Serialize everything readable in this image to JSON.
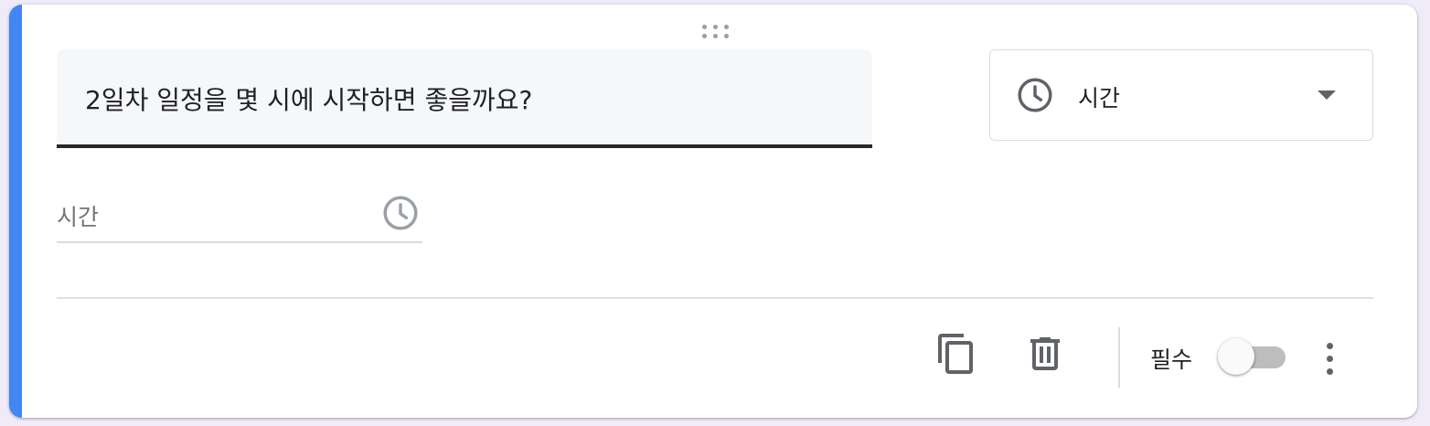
{
  "question": {
    "title": "2일차 일정을 몇 시에 시작하면 좋을까요?"
  },
  "type_selector": {
    "label": "시간",
    "icon": "clock-icon"
  },
  "answer_field": {
    "placeholder": "시간",
    "icon": "clock-icon"
  },
  "footer": {
    "copy_icon": "copy-icon",
    "delete_icon": "trash-icon",
    "required_label": "필수",
    "required_on": false,
    "more_icon": "more-vert-icon"
  },
  "colors": {
    "accent": "#4285f4",
    "text": "#202124",
    "icon": "#5f6368",
    "muted_icon": "#9aa0a6",
    "background": "#f0ebf8"
  }
}
